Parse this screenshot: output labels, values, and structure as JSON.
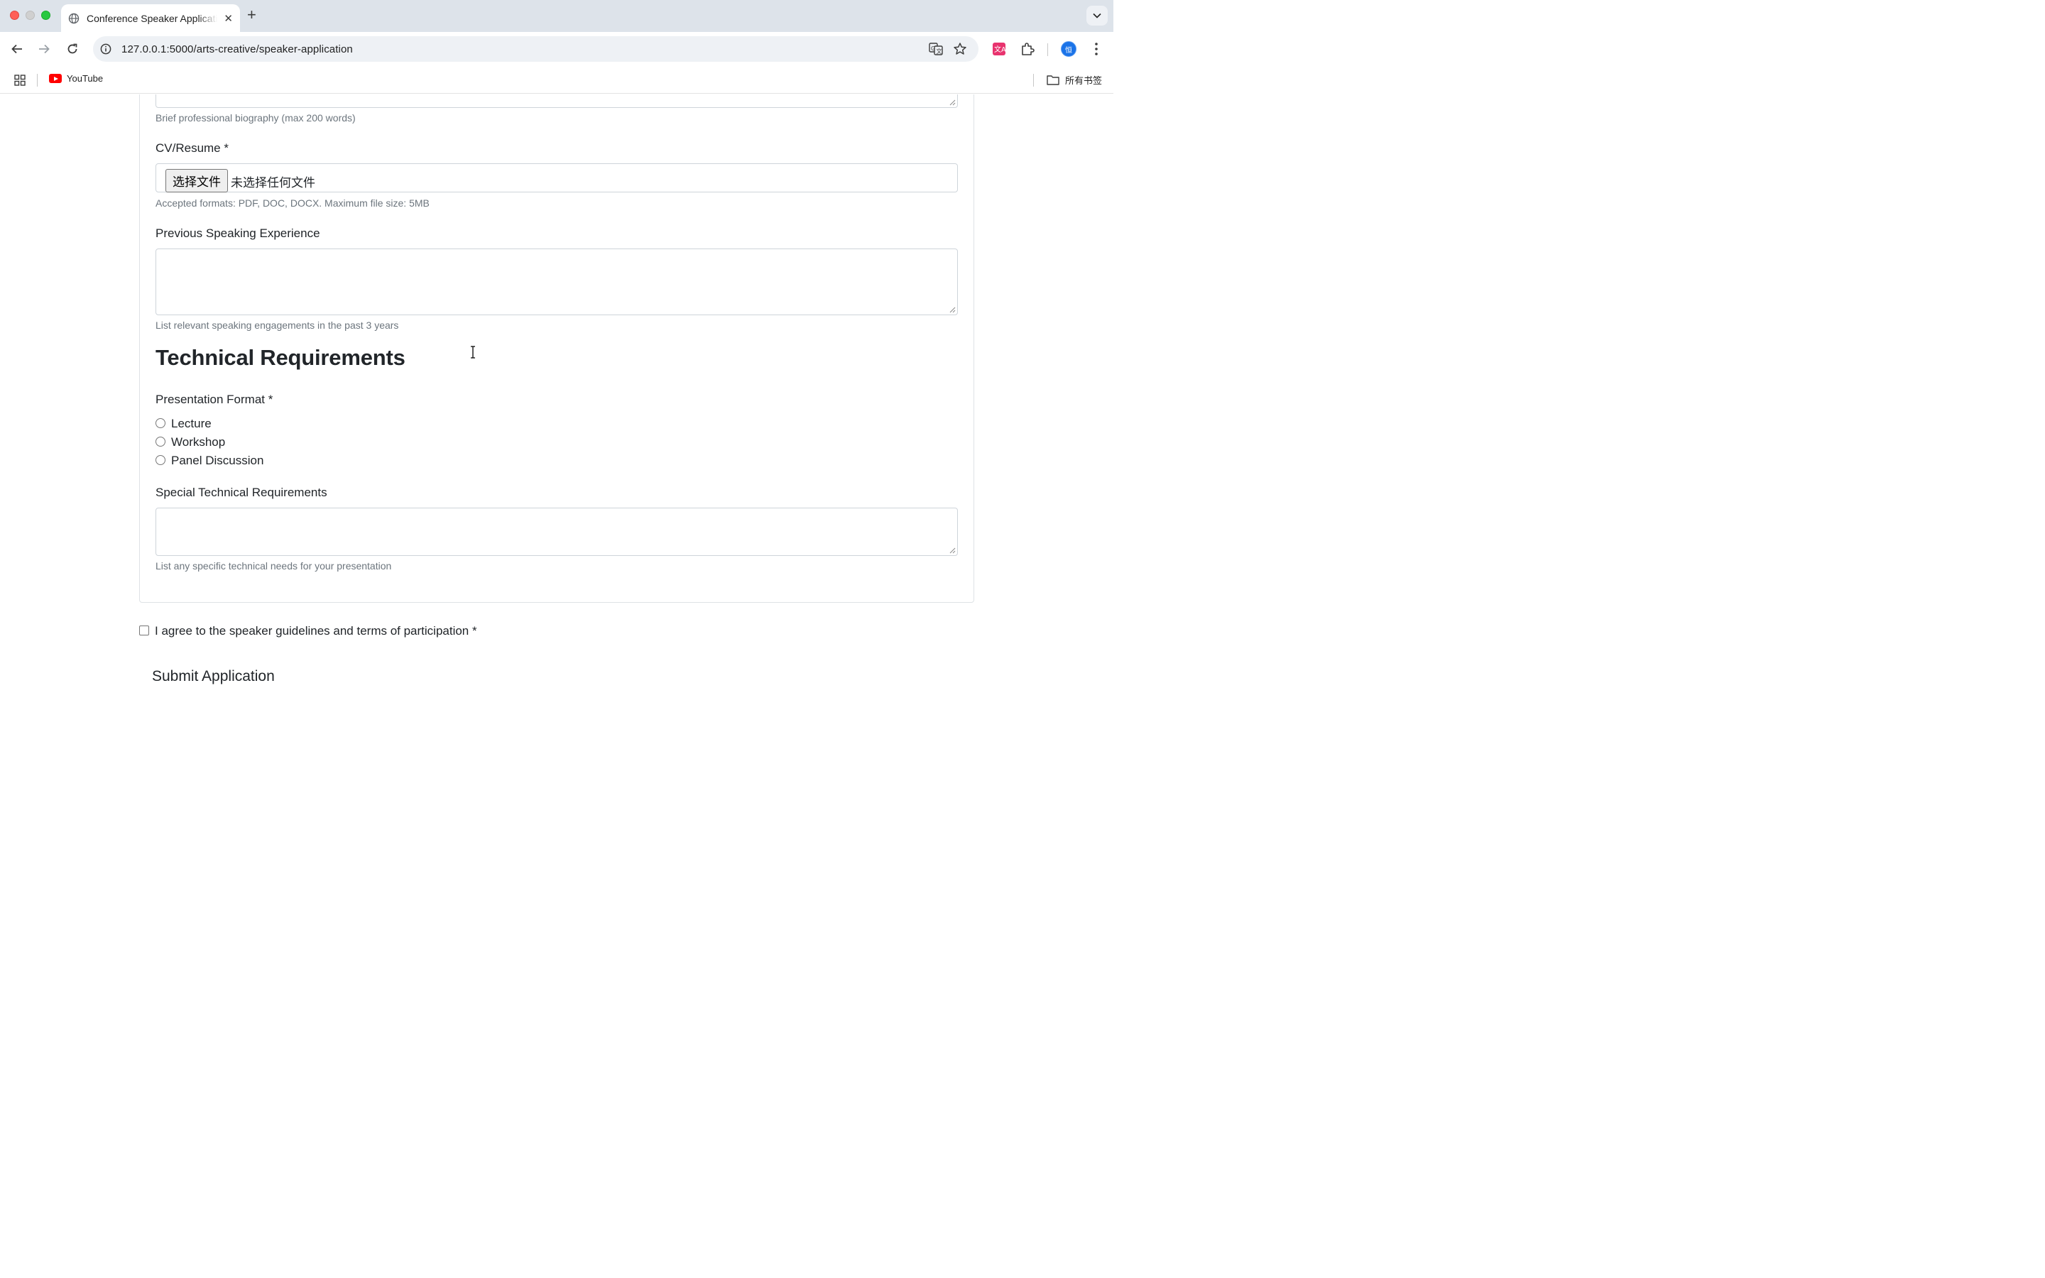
{
  "browser": {
    "tab_title": "Conference Speaker Application",
    "url": "127.0.0.1:5000/arts-creative/speaker-application",
    "avatar_letter": "恒",
    "bookmarks": [
      {
        "label": "YouTube",
        "icon": "youtube-icon"
      }
    ],
    "all_bookmarks_label": "所有书签"
  },
  "form": {
    "bio_help": "Brief professional biography (max 200 words)",
    "cv_label": "CV/Resume *",
    "cv_button": "选择文件",
    "cv_status": "未选择任何文件",
    "cv_help": "Accepted formats: PDF, DOC, DOCX. Maximum file size: 5MB",
    "experience_label": "Previous Speaking Experience",
    "experience_help": "List relevant speaking engagements in the past 3 years",
    "tech_section_title": "Technical Requirements",
    "format_label": "Presentation Format *",
    "format_options": [
      "Lecture",
      "Workshop",
      "Panel Discussion"
    ],
    "special_label": "Special Technical Requirements",
    "special_help": "List any specific technical needs for your presentation",
    "agree_label": "I agree to the speaker guidelines and terms of participation *",
    "submit_label": "Submit Application"
  },
  "colors": {
    "tabstrip_bg": "#dde3ea",
    "help_text": "#6c757d",
    "border": "#ced4da"
  }
}
